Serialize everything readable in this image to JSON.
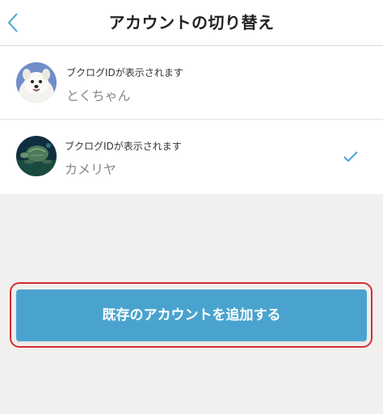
{
  "header": {
    "title": "アカウントの切り替え",
    "back_icon": "chevron-left-icon"
  },
  "accounts": [
    {
      "id_label": "ブクログIDが表示されます",
      "name": "とくちゃん",
      "avatar": "samoyed-dog-avatar",
      "selected": false
    },
    {
      "id_label": "ブクログIDが表示されます",
      "name": "カメリヤ",
      "avatar": "sea-turtle-avatar",
      "selected": true
    }
  ],
  "check_icon": "checkmark-icon",
  "add_button": {
    "label": "既存のアカウントを追加する"
  },
  "colors": {
    "accent": "#4aa3cf",
    "highlight_border": "#d62b36",
    "background": "#f1f0ee"
  }
}
